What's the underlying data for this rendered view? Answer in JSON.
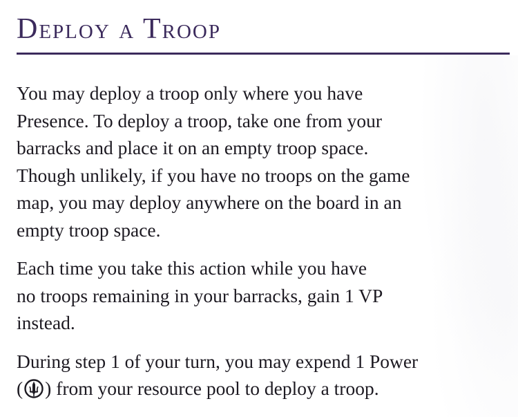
{
  "section": {
    "title": "Deploy a Troop"
  },
  "paragraphs": {
    "p1": {
      "l1": "You may deploy a troop only where you have",
      "l2": "Presence. To deploy a troop, take one from your",
      "l3": "barracks and place it on an empty troop space.",
      "l4": "Though unlikely, if you have no troops on the game",
      "l5": "map, you may deploy anywhere on the board in an",
      "l6": "empty troop space."
    },
    "p2": {
      "l1": "Each time you take this action while you have",
      "l2": "no troops remaining in your barracks, gain 1 VP",
      "l3": "instead."
    },
    "p3": {
      "l1": "During step 1 of your turn, you may expend 1 Power",
      "l2_open": "(",
      "l2_rest": ") from your resource pool to deploy a troop."
    }
  },
  "icons": {
    "power": "power-sword-icon",
    "color": "#1d1a22"
  },
  "colors": {
    "heading": "#3b2a5c",
    "text": "#1d1a22"
  }
}
